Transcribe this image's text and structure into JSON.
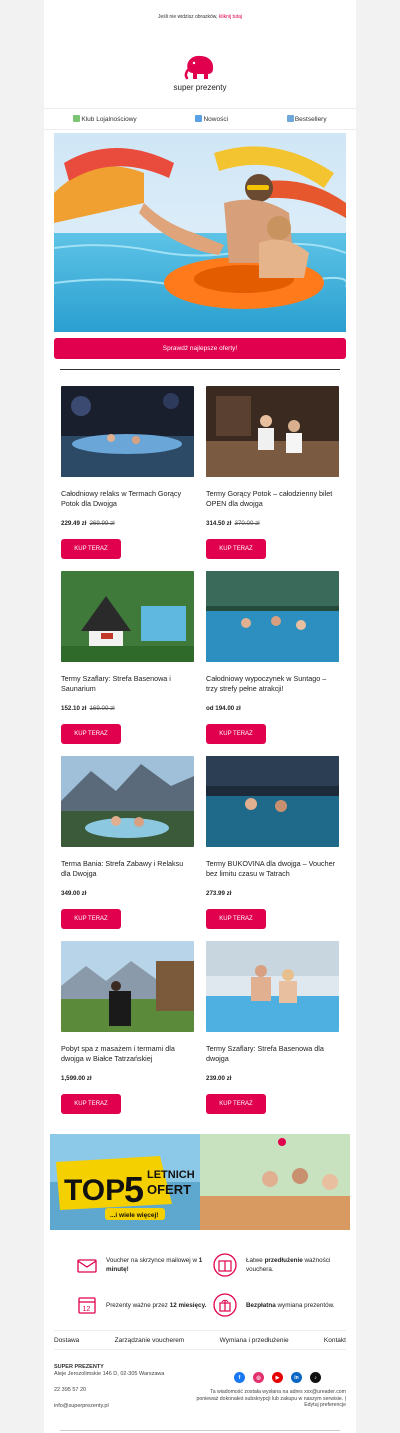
{
  "preheader": {
    "text": "Jeśli nie widzisz obrazków, ",
    "link": "kliknij tutaj"
  },
  "logo": {
    "text": "super prezenty",
    "color": "#e0004d"
  },
  "nav": [
    {
      "label": "Klub Lojalnościowy",
      "icon": "sparkle-icon"
    },
    {
      "label": "Nowości",
      "icon": "new-icon"
    },
    {
      "label": "Bestsellery",
      "icon": "top-icon"
    }
  ],
  "hero": {
    "cta": "Sprawdź najlepsze oferty!"
  },
  "products": [
    {
      "title": "Całodniowy relaks w Termach Gorący Potok dla Dwojga",
      "price": "229.49 zł",
      "old_price": "269.99 zł",
      "buy": "KUP TERAZ"
    },
    {
      "title": "Termy Gorący Potok – całodzienny bilet OPEN dla dwojga",
      "price": "314.50 zł",
      "old_price": "370.00 zł",
      "buy": "KUP TERAZ"
    },
    {
      "title": "Termy Szaflary: Strefa Basenowa i Saunarium",
      "price": "152.10 zł",
      "old_price": "169.00 zł",
      "buy": "KUP TERAZ"
    },
    {
      "title": "Całodniowy wypoczynek w Suntago – trzy strefy pełne atrakcji!",
      "price": "od 194.00 zł",
      "old_price": "",
      "buy": "KUP TERAZ"
    },
    {
      "title": "Terma Bania: Strefa Zabawy i Relaksu dla Dwojga",
      "price": "349.00 zł",
      "old_price": "",
      "buy": "KUP TERAZ"
    },
    {
      "title": "Termy BUKOVINA dla dwojga – Voucher bez limitu czasu w Tatrach",
      "price": "273.99 zł",
      "old_price": "",
      "buy": "KUP TERAZ"
    },
    {
      "title": "Pobyt spa z masażem i termami dla dwojga w Białce Tatrzańskiej",
      "price": "1,599.00 zł",
      "old_price": "",
      "buy": "KUP TERAZ"
    },
    {
      "title": "Termy Szaflary: Strefa Basenowa dla dwojga",
      "price": "239.00 zł",
      "old_price": "",
      "buy": "KUP TERAZ"
    }
  ],
  "banner": {
    "top": "TOP",
    "five": "5",
    "line1": "LETNICH",
    "line2": "OFERT",
    "sub": "...i wiele więcej!"
  },
  "features": [
    {
      "pre": "Voucher na skrzynce mailowej w ",
      "bold": "1 minutę!",
      "post": "",
      "icon": "envelope-icon"
    },
    {
      "pre": "Łatwe ",
      "bold": "przedłużenie",
      "post": " ważności vouchera.",
      "icon": "calendar-gift-icon"
    },
    {
      "pre": "Prezenty ważne przez ",
      "bold": "12 miesięcy.",
      "post": "",
      "icon": "calendar-12-icon"
    },
    {
      "pre": "",
      "bold": "Bezpłatna",
      "post": " wymiana prezentów.",
      "icon": "gift-exchange-icon"
    }
  ],
  "footer_links": [
    "Dostawa",
    "Zarządzanie voucherem",
    "Wymiana i przedłużenie",
    "Kontakt"
  ],
  "company": {
    "name": "SUPER PREZENTY",
    "address": "Aleje Jerozolimskie 146 D, 02-305 Warszawa",
    "phone": "22 395 57 20",
    "email": "info@superprezenty.pl"
  },
  "socials": [
    {
      "name": "facebook-icon",
      "glyph": "f",
      "color": "#1877f2"
    },
    {
      "name": "instagram-icon",
      "glyph": "◎",
      "color": "#e1306c"
    },
    {
      "name": "youtube-icon",
      "glyph": "▶",
      "color": "#e60000"
    },
    {
      "name": "linkedin-icon",
      "glyph": "in",
      "color": "#0a66c2"
    },
    {
      "name": "tiktok-icon",
      "glyph": "♪",
      "color": "#111111"
    }
  ],
  "notice": {
    "text": "Ta wiadomość została wysłana na adres xxx@ureader.com ponieważ dokonałeś subskrypcji lub zakupu w naszym serwisie.",
    "link": "Edytuj preferencje"
  }
}
